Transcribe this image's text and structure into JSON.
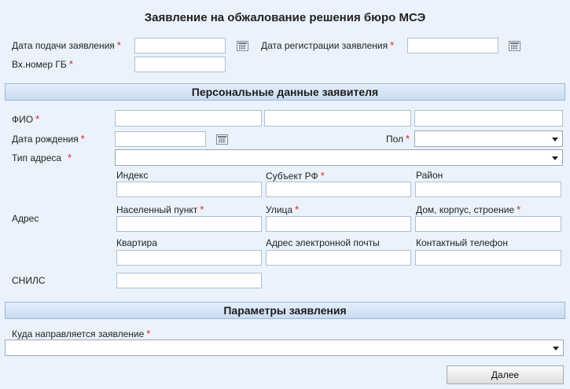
{
  "title": "Заявление на обжалование решения бюро МСЭ",
  "required_mark": "*",
  "header_fields": {
    "submit_date_label": "Дата подачи заявления",
    "registration_date_label": "Дата регистрации заявления",
    "incoming_number_label": "Вх.номер ГБ"
  },
  "personal": {
    "section_title": "Персональные данные заявителя",
    "fio_label": "ФИО",
    "birth_date_label": "Дата рождения",
    "gender_label": "Пол",
    "address_type_label": "Тип адреса",
    "address_label": "Адрес",
    "snils_label": "СНИЛС",
    "address_fields": {
      "index_label": "Индекс",
      "region_label": "Субъект РФ",
      "district_label": "Район",
      "locality_label": "Населенный пункт",
      "street_label": "Улица",
      "house_label": "Дом, корпус, строение",
      "apartment_label": "Квартира",
      "email_label": "Адрес электронной почты",
      "phone_label": "Контактный телефон"
    }
  },
  "params": {
    "section_title": "Параметры заявления",
    "destination_label": "Куда направляется заявление"
  },
  "buttons": {
    "next_label": "Далее"
  }
}
